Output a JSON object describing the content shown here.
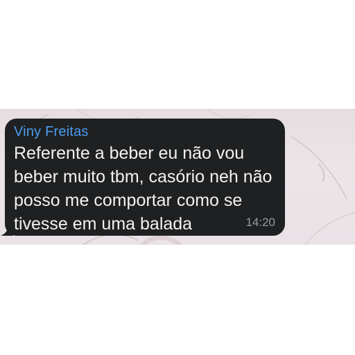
{
  "message": {
    "sender": "Viny Freitas",
    "lines": [
      "Referente a beber eu não vou",
      "beber muito tbm, casório neh não",
      "posso me comportar como se",
      "tivesse em uma balada"
    ],
    "time": "14:20"
  },
  "colors": {
    "bubble": "#1f2021",
    "sender": "#4a9df0",
    "text": "#f2f2f2",
    "time": "#9a9b9d",
    "wallpaper": "#e9e0e4"
  }
}
